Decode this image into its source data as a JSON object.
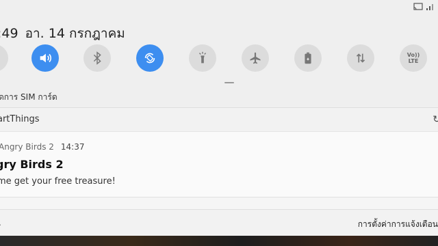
{
  "status_bar": {
    "icons": [
      "cast-icon",
      "signal-icon"
    ]
  },
  "header": {
    "time": ":49",
    "date": "อา. 14 กรกฎาคม"
  },
  "quick_settings": [
    {
      "name": "partial-tile-icon",
      "active": false
    },
    {
      "name": "sound-icon",
      "active": true
    },
    {
      "name": "bluetooth-icon",
      "active": false
    },
    {
      "name": "auto-rotate-icon",
      "active": true
    },
    {
      "name": "flashlight-icon",
      "active": false
    },
    {
      "name": "airplane-icon",
      "active": false
    },
    {
      "name": "battery-saver-icon",
      "active": false
    },
    {
      "name": "mobile-data-icon",
      "active": false
    },
    {
      "name": "volte-icon",
      "active": false,
      "label": "Vo)) LTE"
    }
  ],
  "sim": {
    "text": "ดการ SIM การ์ด"
  },
  "smartthings": {
    "label": "artThings"
  },
  "notification": {
    "app": "Angry Birds 2",
    "time": "14:37",
    "title": "gry Birds 2",
    "body": "me get your free treasure!"
  },
  "peek": {
    "text": ""
  },
  "bottom_bar": {
    "left": ".",
    "right": "การตั้งค่าการแจ้งเตือน"
  }
}
